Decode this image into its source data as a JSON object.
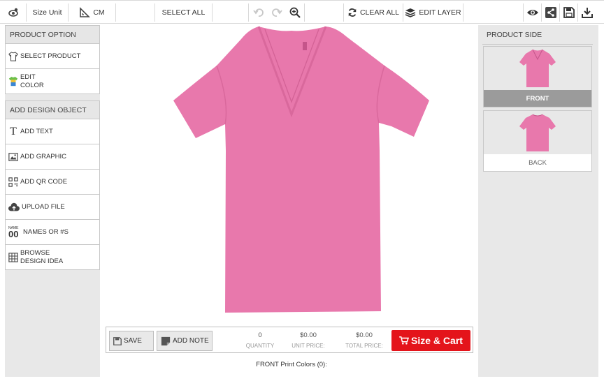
{
  "toolbar": {
    "size_unit_label": "Size Unit",
    "unit_value": "CM",
    "select_all": "SELECT ALL",
    "clear_all": "CLEAR ALL",
    "edit_layer": "EDIT LAYER"
  },
  "left": {
    "product_option_header": "PRODUCT OPTION",
    "select_product": "SELECT PRODUCT",
    "edit_color_l1": "EDIT",
    "edit_color_l2": "COLOR",
    "add_design_header": "ADD DESIGN OBJECT",
    "add_text": "ADD TEXT",
    "add_graphic": "ADD GRAPHIC",
    "add_qr": "ADD QR CODE",
    "upload_file": "UPLOAD FILE",
    "names_or_numbers": "NAMES OR #S",
    "names_icon_top": "NAME",
    "names_icon_num": "00",
    "browse_l1": "BROWSE",
    "browse_l2": "DESIGN IDEA"
  },
  "bottom": {
    "save": "SAVE",
    "add_note": "ADD NOTE",
    "quantity_value": "0",
    "quantity_label": "QUANTITY",
    "unit_price_value": "$0.00",
    "unit_price_label": "UNIT PRICE:",
    "total_price_value": "$0.00",
    "total_price_label": "TOTAL PRICE:",
    "cart_button": "Size & Cart",
    "print_colors": "FRONT Print Colors  (0):"
  },
  "right": {
    "product_side_header": "PRODUCT SIDE",
    "front_label": "FRONT",
    "back_label": "BACK"
  },
  "colors": {
    "shirt": "#e878ac",
    "accent_red": "#e4141b",
    "active_side": "#9b9b9b"
  }
}
